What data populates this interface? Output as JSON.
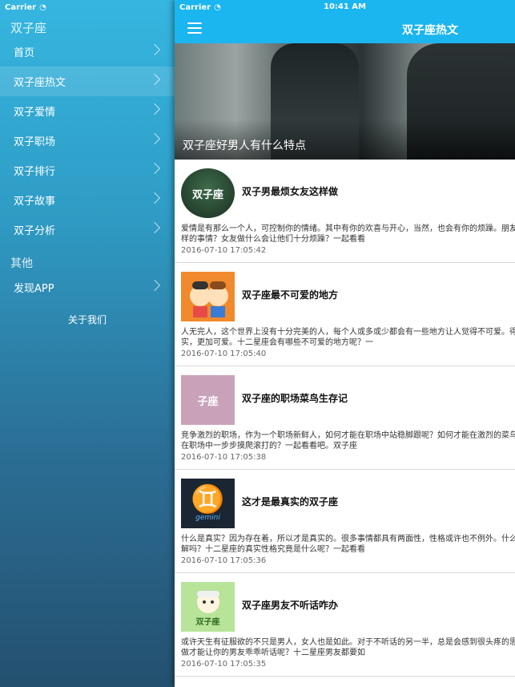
{
  "status": {
    "carrier": "Carrier",
    "time": "10:41 AM"
  },
  "sidebar": {
    "title": "双子座",
    "items": [
      {
        "label": "首页"
      },
      {
        "label": "双子座热文"
      },
      {
        "label": "双子爱情"
      },
      {
        "label": "双子职场"
      },
      {
        "label": "双子排行"
      },
      {
        "label": "双子故事"
      },
      {
        "label": "双子分析"
      }
    ],
    "section_other": "其他",
    "other_items": [
      {
        "label": "发现APP"
      }
    ],
    "about": "关于我们"
  },
  "header": {
    "title": "双子座热文"
  },
  "hero": {
    "title": "双子座好男人有什么特点"
  },
  "articles": [
    {
      "title": "双子男最烦女友这样做",
      "thumb": "双子座",
      "desc": "爱情是有那么一个人，可控制你的情绪。其中有你的欢喜与开心，当然，也会有你的烦躁。朋友做出什么样的事情？女友做什么会让他们十分烦躁？一起看看",
      "date": "2016-07-10 17:05:42"
    },
    {
      "title": "双子座最不可爱的地方",
      "thumb": "",
      "desc": "人无完人，这个世界上没有十分完美的人，每个人或多或少都会有一些地方让人觉得不可爱。得你更加真实，更加可爱。十二星座会有哪些不可爱的地方呢？一",
      "date": "2016-07-10 17:05:40"
    },
    {
      "title": "双子座的职场菜鸟生存记",
      "thumb": "子座",
      "desc": "竞争激烈的职场，作为一个职场新鲜人，如何才能在职场中站稳脚跟呢？如何才能在激烈的菜鸟都是如何在职场中一步步摸爬滚打的？一起看看吧。双子座",
      "date": "2016-07-10 17:05:38"
    },
    {
      "title": "这才是最真实的双子座",
      "thumb": "gemini",
      "desc": "什么是真实？因为存在着，所以才是真实的。很多事情都具有两面性，性格或许也不例外。什么样的你了解吗？十二星座的真实性格究竟是什么呢？一起看看",
      "date": "2016-07-10 17:05:36"
    },
    {
      "title": "双子座男友不听话咋办",
      "thumb": "双子座",
      "desc": "或许天生有征服欲的不只是男人，女人也是如此。对于不听话的另一半，总是会感到很头疼的思维。如何做才能让你的男友乖乖听话呢？十二星座男友都要如",
      "date": "2016-07-10 17:05:35"
    }
  ]
}
